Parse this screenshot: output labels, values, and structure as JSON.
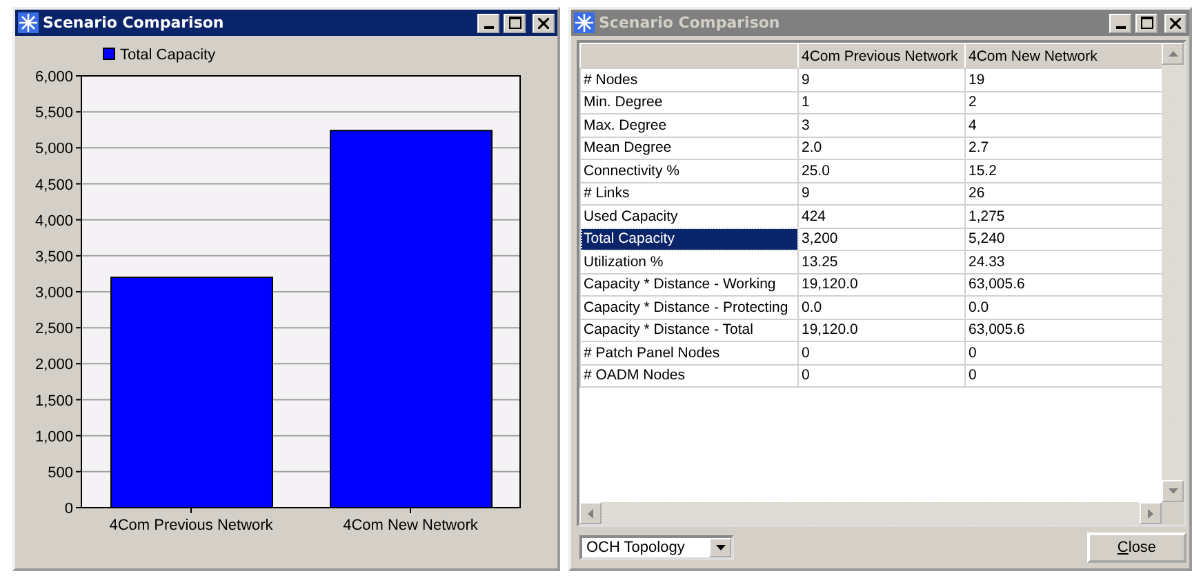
{
  "windows": [
    {
      "title": "Scenario Comparison",
      "active": true,
      "chart_data": {
        "type": "bar",
        "grid": true,
        "categories": [
          "4Com Previous Network",
          "4Com New Network"
        ],
        "series": [
          {
            "name": "Total Capacity",
            "color": "#0000ff",
            "values": [
              3200,
              5240
            ]
          }
        ],
        "ylim": [
          0,
          6000
        ],
        "yticks": [
          {
            "value": 0,
            "label": "0"
          },
          {
            "value": 500,
            "label": "500"
          },
          {
            "value": 1000,
            "label": "1,000"
          },
          {
            "value": 1500,
            "label": "1,500"
          },
          {
            "value": 2000,
            "label": "2,000"
          },
          {
            "value": 2500,
            "label": "2,500"
          },
          {
            "value": 3000,
            "label": "3,000"
          },
          {
            "value": 3500,
            "label": "3,500"
          },
          {
            "value": 4000,
            "label": "4,000"
          },
          {
            "value": 4500,
            "label": "4,500"
          },
          {
            "value": 5000,
            "label": "5,000"
          },
          {
            "value": 5500,
            "label": "5,500"
          },
          {
            "value": 6000,
            "label": "6,000"
          }
        ]
      }
    },
    {
      "title": "Scenario Comparison",
      "active": false,
      "table": {
        "columns": [
          "4Com Previous Network",
          "4Com New Network"
        ],
        "rows": [
          {
            "label": "# Nodes",
            "values": [
              "9",
              "19"
            ],
            "selected": false
          },
          {
            "label": "Min. Degree",
            "values": [
              "1",
              "2"
            ],
            "selected": false
          },
          {
            "label": "Max. Degree",
            "values": [
              "3",
              "4"
            ],
            "selected": false
          },
          {
            "label": "Mean Degree",
            "values": [
              "2.0",
              "2.7"
            ],
            "selected": false
          },
          {
            "label": "Connectivity %",
            "values": [
              "25.0",
              "15.2"
            ],
            "selected": false
          },
          {
            "label": "# Links",
            "values": [
              "9",
              "26"
            ],
            "selected": false
          },
          {
            "label": "Used Capacity",
            "values": [
              "424",
              "1,275"
            ],
            "selected": false
          },
          {
            "label": "Total Capacity",
            "values": [
              "3,200",
              "5,240"
            ],
            "selected": true
          },
          {
            "label": "Utilization %",
            "values": [
              "13.25",
              "24.33"
            ],
            "selected": false
          },
          {
            "label": "Capacity * Distance - Working",
            "values": [
              "19,120.0",
              "63,005.6"
            ],
            "selected": false
          },
          {
            "label": "Capacity * Distance - Protecting",
            "values": [
              "0.0",
              "0.0"
            ],
            "selected": false
          },
          {
            "label": "Capacity * Distance - Total",
            "values": [
              "19,120.0",
              "63,005.6"
            ],
            "selected": false
          },
          {
            "label": "# Patch Panel Nodes",
            "values": [
              "0",
              "0"
            ],
            "selected": false
          },
          {
            "label": "# OADM Nodes",
            "values": [
              "0",
              "0"
            ],
            "selected": false
          }
        ]
      },
      "topology_select": "OCH Topology",
      "close_button": "Close"
    }
  ]
}
